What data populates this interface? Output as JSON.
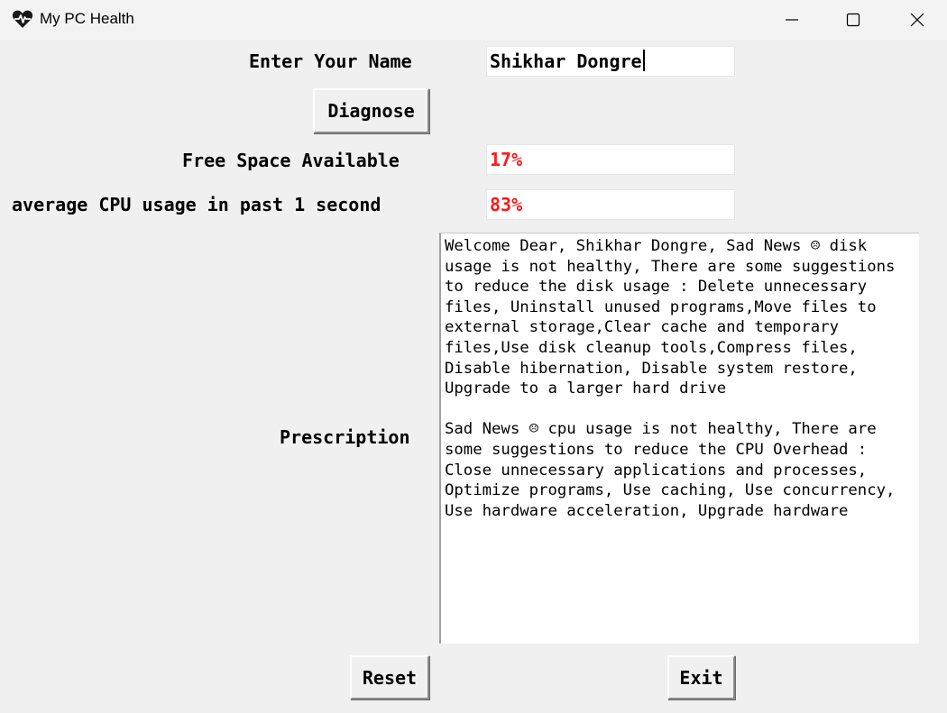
{
  "window": {
    "title": "My PC Health",
    "icon": "heart-pulse-icon",
    "controls": [
      "minimize-icon",
      "maximize-icon",
      "close-icon"
    ]
  },
  "form": {
    "name_label": "Enter Your Name",
    "name_value": "Shikhar Dongre",
    "diagnose_button": "Diagnose",
    "free_space_label": "Free Space Available",
    "free_space_value": "17%",
    "cpu_label": "average CPU usage in past 1 second",
    "cpu_value": "83%",
    "prescription_label": "Prescription",
    "prescription_text": "Welcome Dear, Shikhar Dongre, Sad News ☹ disk\nusage is not healthy, There are some suggestions\nto reduce the disk usage : Delete unnecessary\nfiles, Uninstall unused programs,Move files to\nexternal storage,Clear cache and temporary\nfiles,Use disk cleanup tools,Compress files,\nDisable hibernation, Disable system restore,\nUpgrade to a larger hard drive\n\nSad News ☹ cpu usage is not healthy, There are\nsome suggestions to reduce the CPU Overhead :\nClose unnecessary applications and processes,\nOptimize programs, Use caching, Use concurrency,\nUse hardware acceleration, Upgrade hardware",
    "reset_button": "Reset",
    "exit_button": "Exit"
  },
  "colors": {
    "value_alert": "#ff1a1a",
    "window_bg": "#f0f0f0"
  }
}
